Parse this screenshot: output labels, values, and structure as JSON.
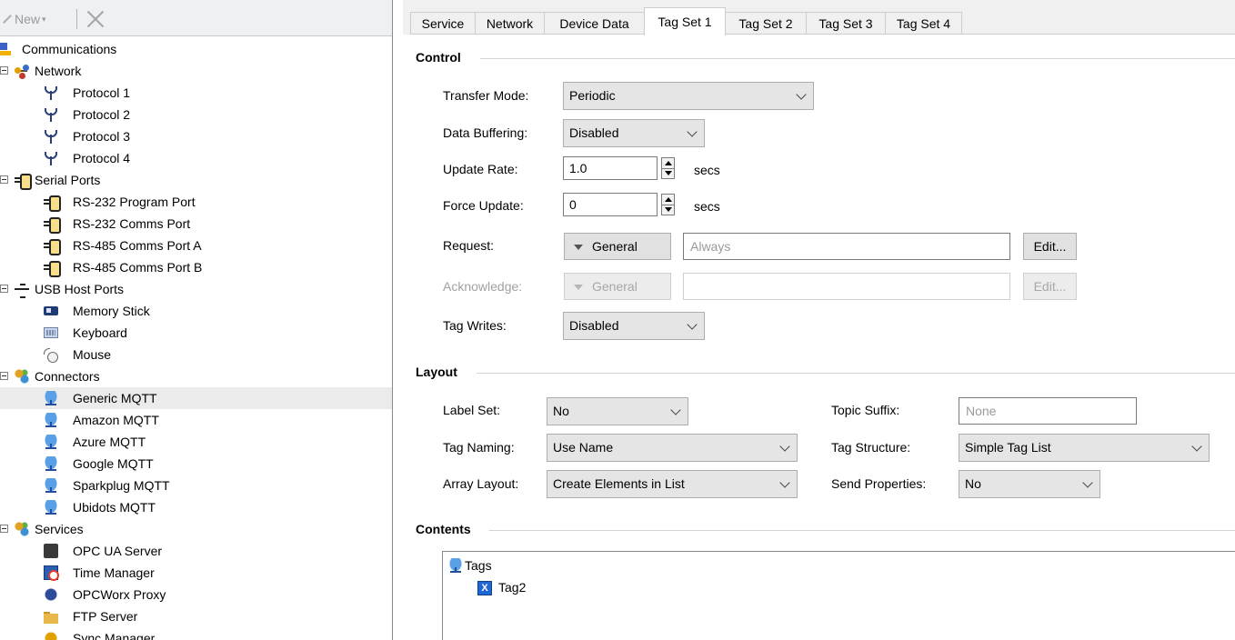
{
  "toolbar": {
    "new_label": "New",
    "new_caret": "▾"
  },
  "tree": {
    "items": [
      {
        "label": "Communications"
      },
      {
        "label": "Network"
      },
      {
        "label": "Protocol 1"
      },
      {
        "label": "Protocol 2"
      },
      {
        "label": "Protocol 3"
      },
      {
        "label": "Protocol 4"
      },
      {
        "label": "Serial Ports"
      },
      {
        "label": "RS-232 Program Port"
      },
      {
        "label": "RS-232 Comms Port"
      },
      {
        "label": "RS-485 Comms Port A"
      },
      {
        "label": "RS-485 Comms Port B"
      },
      {
        "label": "USB Host Ports"
      },
      {
        "label": "Memory Stick"
      },
      {
        "label": "Keyboard"
      },
      {
        "label": "Mouse"
      },
      {
        "label": "Connectors"
      },
      {
        "label": "Generic MQTT"
      },
      {
        "label": "Amazon MQTT"
      },
      {
        "label": "Azure MQTT"
      },
      {
        "label": "Google MQTT"
      },
      {
        "label": "Sparkplug MQTT"
      },
      {
        "label": "Ubidots MQTT"
      },
      {
        "label": "Services"
      },
      {
        "label": "OPC UA Server"
      },
      {
        "label": "Time Manager"
      },
      {
        "label": "OPCWorx Proxy"
      },
      {
        "label": "FTP Server"
      },
      {
        "label": "Sync Manager"
      }
    ],
    "selected": "Generic MQTT"
  },
  "tabs": [
    {
      "label": "Service"
    },
    {
      "label": "Network"
    },
    {
      "label": "Device Data"
    },
    {
      "label": "Tag Set 1",
      "active": true
    },
    {
      "label": "Tag Set 2"
    },
    {
      "label": "Tag Set 3"
    },
    {
      "label": "Tag Set 4"
    }
  ],
  "control": {
    "title": "Control",
    "transfer_mode": {
      "label": "Transfer Mode:",
      "value": "Periodic"
    },
    "data_buffering": {
      "label": "Data Buffering:",
      "value": "Disabled"
    },
    "update_rate": {
      "label": "Update Rate:",
      "value": "1.0",
      "unit": "secs"
    },
    "force_update": {
      "label": "Force Update:",
      "value": "0",
      "unit": "secs"
    },
    "request": {
      "label": "Request:",
      "button": "General",
      "value": "Always",
      "edit": "Edit..."
    },
    "acknowledge": {
      "label": "Acknowledge:",
      "button": "General",
      "value": "",
      "edit": "Edit..."
    },
    "tag_writes": {
      "label": "Tag Writes:",
      "value": "Disabled"
    }
  },
  "layout": {
    "title": "Layout",
    "label_set": {
      "label": "Label Set:",
      "value": "No"
    },
    "tag_naming": {
      "label": "Tag Naming:",
      "value": "Use Name"
    },
    "array_layout": {
      "label": "Array Layout:",
      "value": "Create Elements in List"
    },
    "topic_suffix": {
      "label": "Topic Suffix:",
      "placeholder": "None"
    },
    "tag_structure": {
      "label": "Tag Structure:",
      "value": "Simple Tag List"
    },
    "send_properties": {
      "label": "Send Properties:",
      "value": "No"
    }
  },
  "contents": {
    "title": "Contents",
    "root": "Tags",
    "children": [
      "Tag2"
    ],
    "tag_icon_letter": "X"
  }
}
